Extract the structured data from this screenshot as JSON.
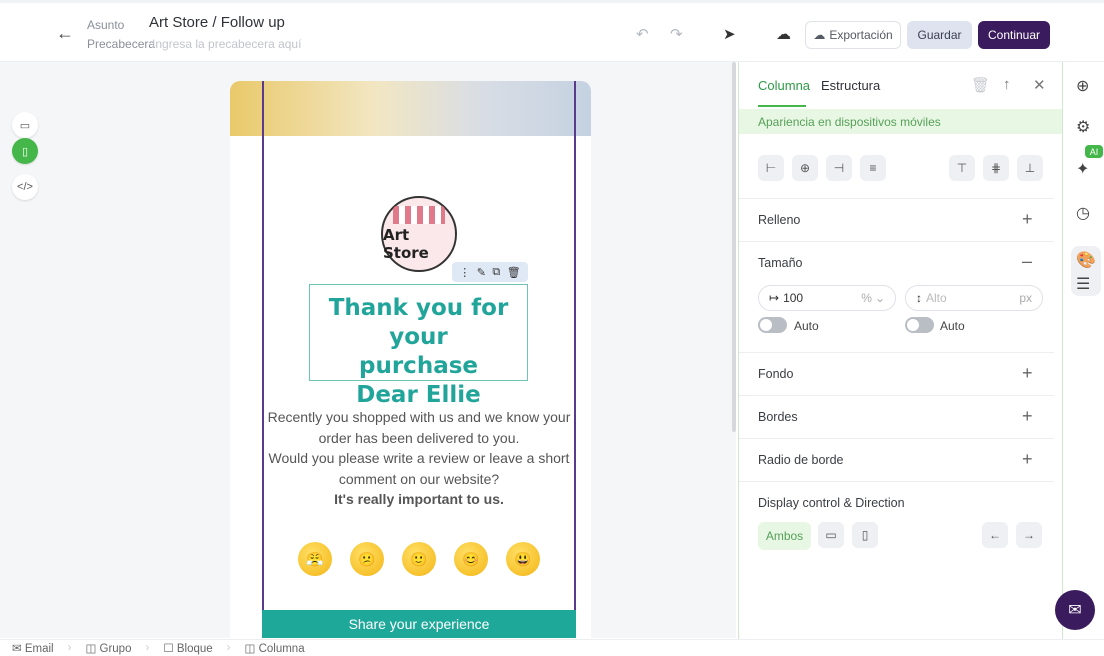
{
  "header": {
    "subject_label": "Asunto",
    "subject_value": "Art Store / Follow up",
    "preheader_label": "Precabecera",
    "preheader_placeholder": "Ingresa la precabecera aquí",
    "export_label": "Exportación",
    "save_label": "Guardar",
    "continue_label": "Continuar"
  },
  "email": {
    "logo_text": "Art Store",
    "heading": "Thank you for your\npurchase\nDear Ellie",
    "body_lines": [
      "Recently you shopped with us and we know your",
      "order has been delivered to you.",
      "Would you please write a review or leave a short",
      "comment on our website?"
    ],
    "body_bold": "It's really important to us.",
    "emojis": [
      "😤",
      "😕",
      "🙂",
      "😊",
      "😃"
    ],
    "cta_label": "Share your experience"
  },
  "panel": {
    "tabs": [
      "Columna",
      "Estructura"
    ],
    "mobile_banner": "Apariencia en dispositivos móviles",
    "sections": {
      "relleno": "Relleno",
      "tamano": "Tamaño",
      "fondo": "Fondo",
      "bordes": "Bordes",
      "radio": "Radio de borde",
      "display": "Display control & Direction"
    },
    "width_value": "100",
    "width_unit": "%",
    "height_placeholder": "Alto",
    "height_unit": "px",
    "auto_label": "Auto",
    "ambos_label": "Ambos"
  },
  "rail": {
    "ai_badge": "AI"
  },
  "breadcrumbs": [
    "Email",
    "Grupo",
    "Bloque",
    "Columna"
  ],
  "colors": {
    "accent": "#45b649",
    "primary": "#3a1b5d",
    "heading": "#21a59a"
  }
}
